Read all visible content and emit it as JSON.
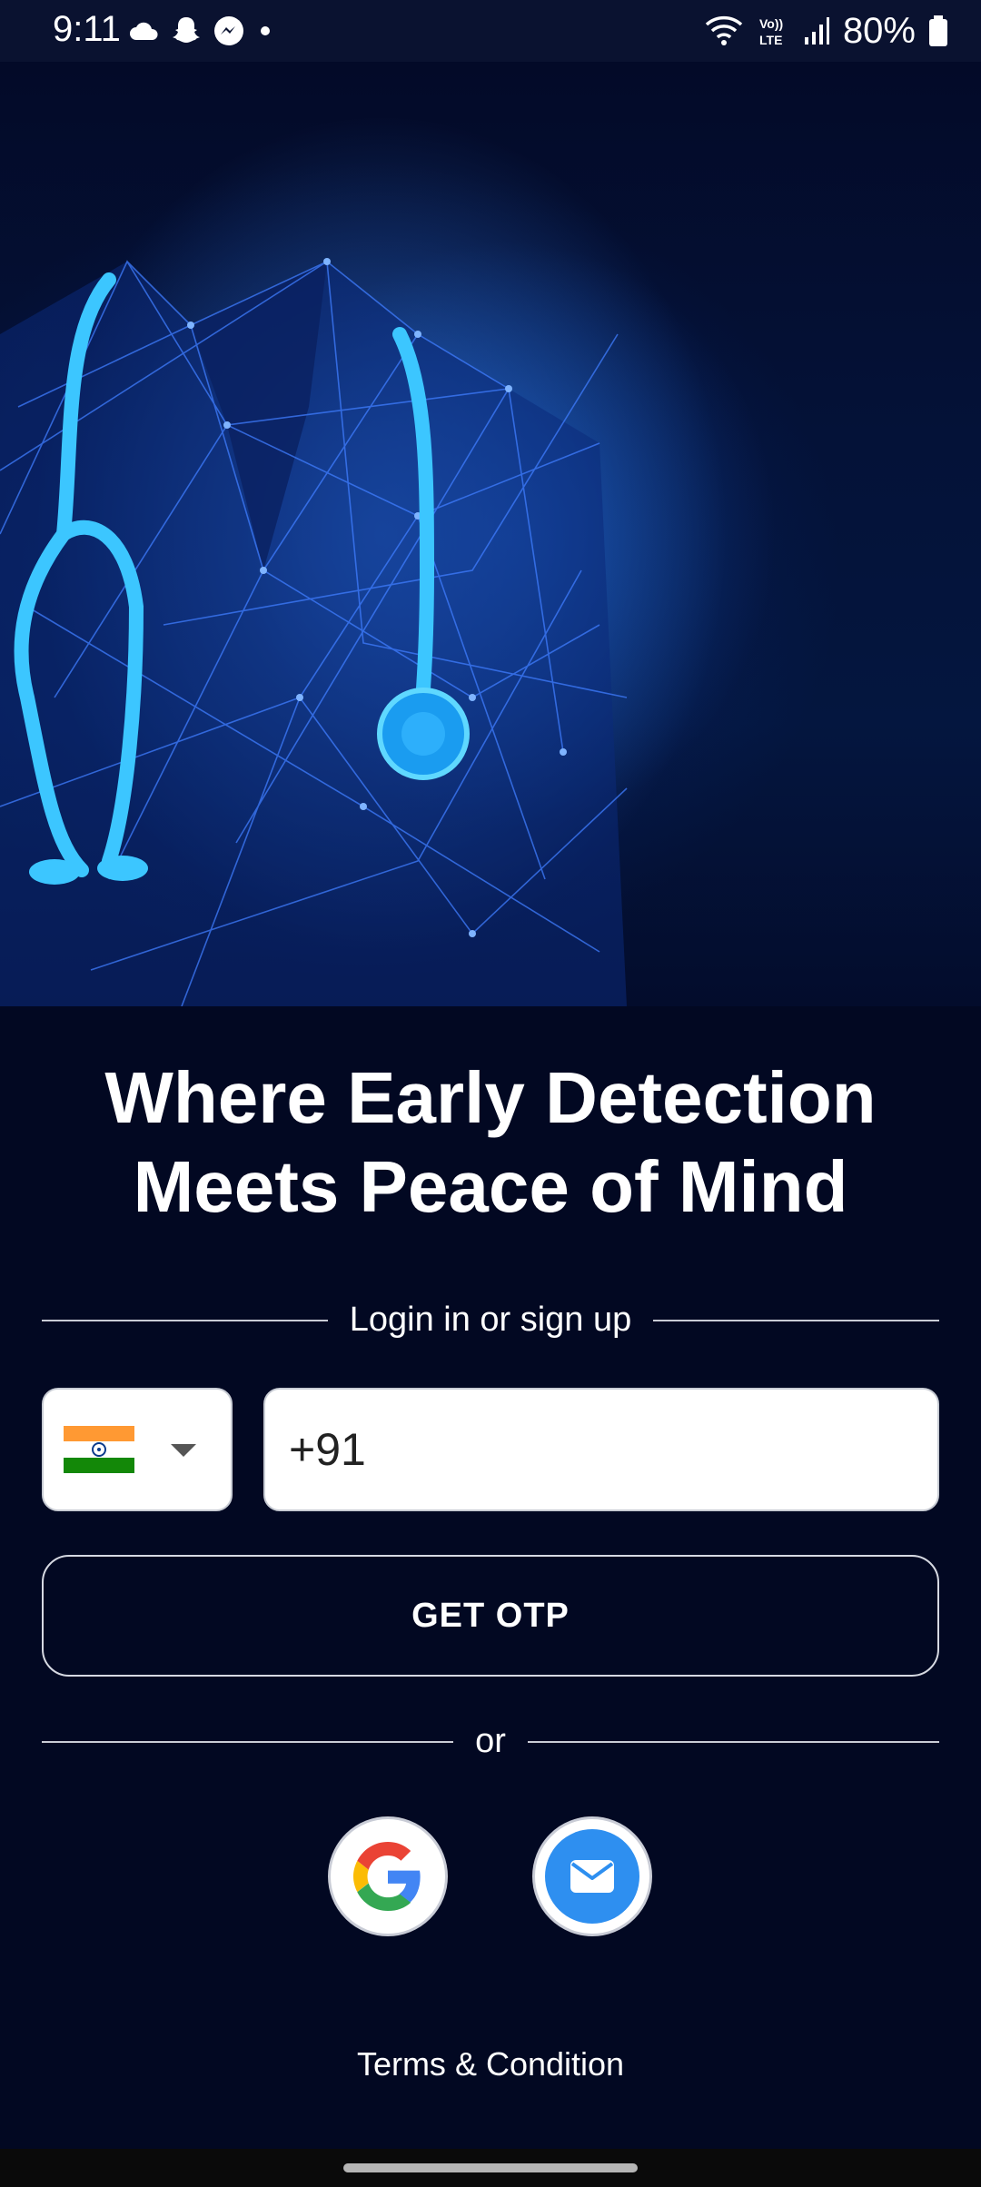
{
  "status_bar": {
    "time": "9:11",
    "battery": "80%",
    "icons": [
      "cloud-icon",
      "snapchat-icon",
      "messenger-icon",
      "dot-icon",
      "wifi-icon",
      "volte-icon",
      "signal-icon",
      "battery-icon"
    ]
  },
  "hero": {
    "image": "doctor-coat-stethoscope-network-illustration"
  },
  "headline": {
    "line1": "Where Early Detection",
    "line2": "Meets Peace of Mind"
  },
  "login": {
    "divider_label": "Login in or sign up",
    "country_flag": "india-flag-icon",
    "phone_value": "+91",
    "otp_label": "GET OTP",
    "or_label": "or"
  },
  "social": {
    "google": "google-icon",
    "email": "email-icon"
  },
  "footer": {
    "terms": "Terms & Condition"
  },
  "colors": {
    "background": "#020822",
    "accent_blue": "#2e8ff0",
    "flag_saffron": "#ff9933",
    "flag_green": "#138808"
  }
}
